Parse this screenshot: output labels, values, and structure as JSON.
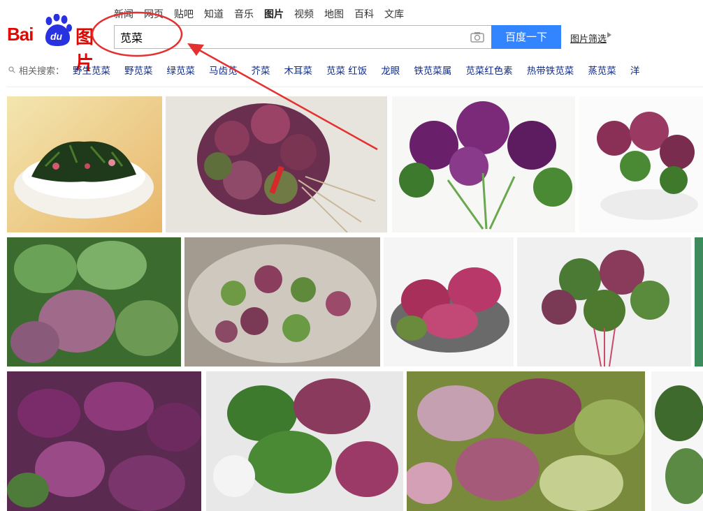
{
  "nav": {
    "items": [
      "新闻",
      "网页",
      "贴吧",
      "知道",
      "音乐",
      "图片",
      "视频",
      "地图",
      "百科",
      "文库"
    ],
    "active_index": 5
  },
  "logo": {
    "bai": "Bai",
    "du": "du",
    "pic": "图片"
  },
  "search": {
    "query": "苋菜",
    "button_label": "百度一下",
    "filter_label": "图片筛选"
  },
  "related": {
    "label": "相关搜索：",
    "items": [
      "野生苋菜",
      "野苋菜",
      "绿苋菜",
      "马齿苋",
      "芥菜",
      "木耳菜",
      "苋菜 红饭",
      "龙眼",
      "铁苋菜属",
      "苋菜红色素",
      "热带铁苋菜",
      "蒸苋菜",
      "洋"
    ]
  },
  "colors": {
    "brand_red": "#e10601",
    "brand_blue": "#2932e1",
    "button_blue": "#3385ff",
    "link_blue": "#0f2c8a",
    "annotation_red": "#e53030"
  },
  "images": [
    {
      "alt": "amaranth salad bowl"
    },
    {
      "alt": "amaranth bunch tied"
    },
    {
      "alt": "purple amaranth bunch"
    },
    {
      "alt": "amaranth bunch small"
    },
    {
      "alt": "amaranth leaves close-up"
    },
    {
      "alt": "amaranth seedlings"
    },
    {
      "alt": "amaranth in bowl"
    },
    {
      "alt": "amaranth bundle"
    },
    {
      "alt": "green amaranth edge"
    },
    {
      "alt": "purple amaranth leaves"
    },
    {
      "alt": "amaranth in plastic bag"
    },
    {
      "alt": "amaranth pile"
    },
    {
      "alt": "green plants edge"
    }
  ]
}
